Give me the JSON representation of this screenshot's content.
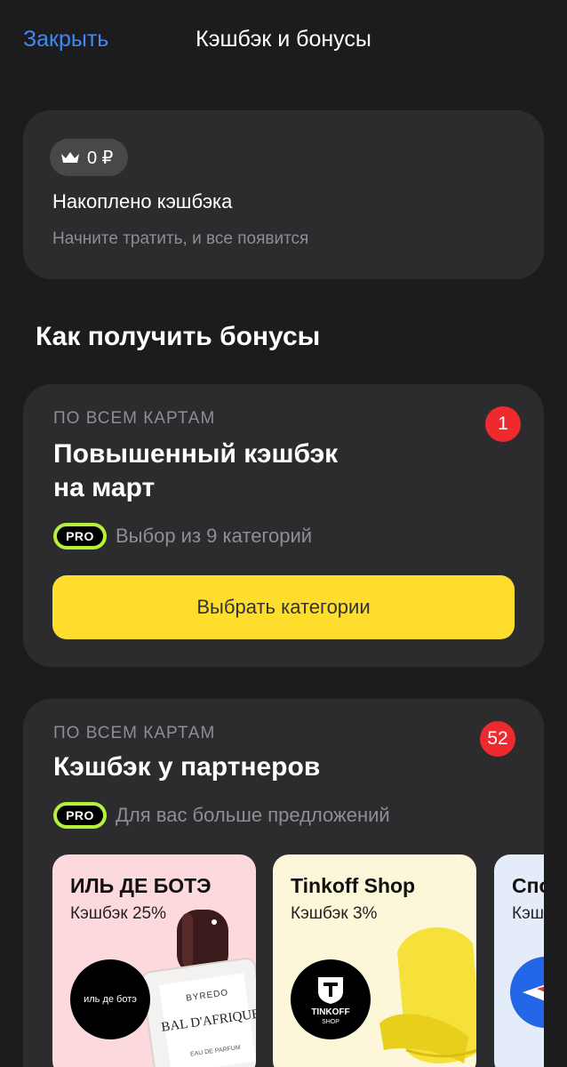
{
  "header": {
    "close_label": "Закрыть",
    "title": "Кэшбэк и бонусы"
  },
  "summary": {
    "balance": "0 ₽",
    "balance_icon": "crown-icon",
    "title": "Накоплено кэшбэка",
    "subtitle": "Начните тратить, и все появится"
  },
  "section": {
    "heading": "Как получить бонусы"
  },
  "offers": [
    {
      "eyebrow": "ПО ВСЕМ КАРТАМ",
      "title_line1": "Повышенный кэшбэк",
      "title_line2": "на март",
      "badge": "1",
      "pro_label": "PRO",
      "pro_text": "Выбор из 9 категорий",
      "button_label": "Выбрать категории"
    },
    {
      "eyebrow": "ПО ВСЕМ КАРТАМ",
      "title": "Кэшбэк у партнеров",
      "badge": "52",
      "pro_label": "PRO",
      "pro_text": "Для вас больше предложений",
      "partners": [
        {
          "name": "ИЛЬ ДЕ БОТЭ",
          "cashback": "Кэшбэк 25%",
          "logo_text": "иль де ботэ",
          "product_brand": "BYREDO",
          "product_name": "BAL D'AFRIQUE",
          "product_sub": "EAU DE PARFUM"
        },
        {
          "name": "Tinkoff Shop",
          "cashback": "Кэшбэк 3%",
          "logo_text": "TINKOFF",
          "logo_sub": "SHOP"
        },
        {
          "name": "Спо",
          "cashback": "Кэш"
        }
      ]
    }
  ],
  "colors": {
    "background": "#1c1c1e",
    "card": "#2c2c2e",
    "accent_link": "#3d8af7",
    "button_yellow": "#ffdd2d",
    "badge_red": "#ee2a2e",
    "pro_green": "#b6f03a"
  }
}
